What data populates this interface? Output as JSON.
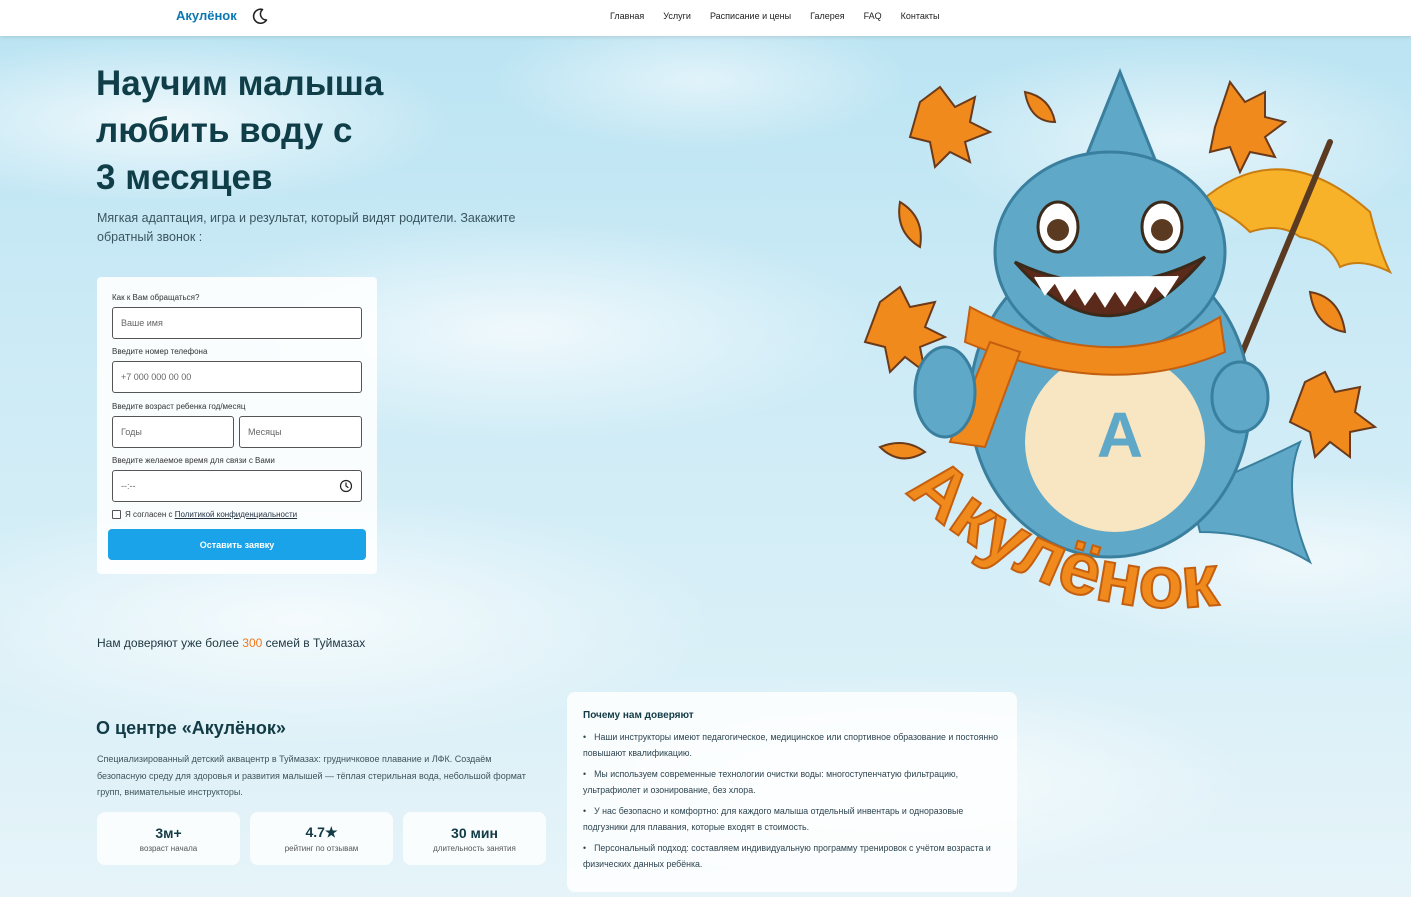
{
  "header": {
    "logo": "Акулёнок",
    "nav": [
      "Главная",
      "Услуги",
      "Расписание и цены",
      "Галерея",
      "FAQ",
      "Контакты"
    ]
  },
  "hero": {
    "title_lines": [
      "Научим малыша",
      "любить воду с",
      "3 месяцев"
    ],
    "subtitle": "Мягкая адаптация, игра и результат, который видят родители. Закажите обратный звонок :"
  },
  "form": {
    "name_label": "Как к Вам обращаться?",
    "name_placeholder": "Ваше имя",
    "phone_label": "Введите номер телефона",
    "phone_placeholder": "+7 000 000 00 00",
    "age_label": "Введите возраст ребенка год/месяц",
    "years_placeholder": "Годы",
    "months_placeholder": "Месяцы",
    "time_label": "Введите желаемое время для связи с Вами",
    "time_value": "--:--",
    "consent_prefix": "Я согласен с ",
    "consent_link": "Политикой конфиденциальности",
    "submit": "Оставить заявку"
  },
  "trust": {
    "prefix": "Нам доверяют уже более ",
    "count": "300",
    "suffix": " семей в Туймазах"
  },
  "about": {
    "title": "О центре «Акулёнок»",
    "text": "Специализированный детский аквацентр в Туймазах: грудничковое плавание и ЛФК. Создаём безопасную среду для здоровья и развития малышей — тёплая стерильная вода, небольшой формат групп, внимательные инструкторы.",
    "stats": [
      {
        "value": "3м+",
        "label": "возраст начала"
      },
      {
        "value": "4.7★",
        "label": "рейтинг по отзывам"
      },
      {
        "value": "30 мин",
        "label": "длительность занятия"
      }
    ]
  },
  "why": {
    "title": "Почему нам доверяют",
    "items": [
      "Наши инструкторы имеют педагогическое, медицинское или спортивное образование и постоянно повышают квалификацию.",
      "Мы используем современные технологии очистки воды: многоступенчатую фильтрацию, ультрафиолет и озонирование, без хлора.",
      "У нас безопасно и комфортно: для каждого малыша отдельный инвентарь и одноразовые подгузники для плавания, которые входят в стоимость.",
      "Персональный подход: составляем индивидуальную программу тренировок с учётом возраста и физических данных ребёнка."
    ]
  },
  "mascot": {
    "badge_letter": "А",
    "brand_text": "Акулёнок"
  },
  "colors": {
    "accent": "#1aa3e8",
    "brand": "#0b78b3",
    "orange": "#f27a1a",
    "heading": "#0f3e48"
  }
}
